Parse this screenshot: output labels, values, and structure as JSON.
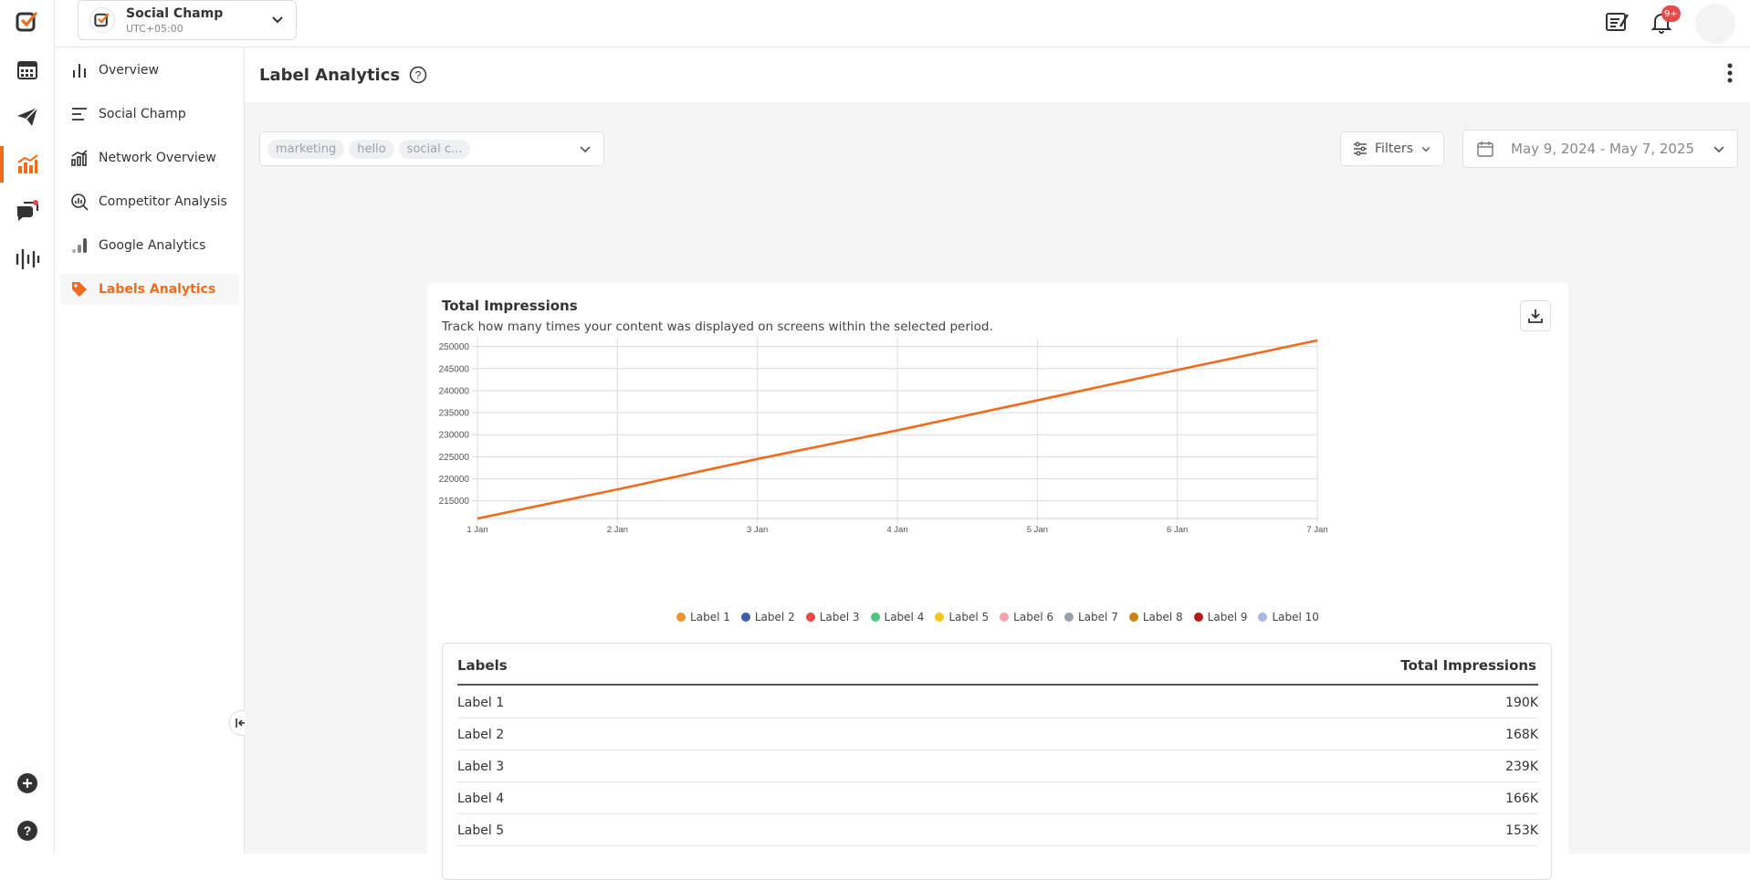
{
  "workspace": {
    "name": "Social Champ",
    "timezone": "UTC+05:00"
  },
  "notifications": {
    "badge": "9+"
  },
  "sidenav": {
    "items": [
      {
        "label": "Overview",
        "icon": "bar-chart-icon"
      },
      {
        "label": "Social Champ",
        "icon": "align-left-icon"
      },
      {
        "label": "Network Overview",
        "icon": "network-chart-icon"
      },
      {
        "label": "Competitor Analysis",
        "icon": "competitor-search-icon"
      },
      {
        "label": "Google Analytics",
        "icon": "google-analytics-icon"
      },
      {
        "label": "Labels Analytics",
        "icon": "tag-icon",
        "active": true
      }
    ]
  },
  "page": {
    "title": "Label Analytics"
  },
  "filters": {
    "chips": [
      "marketing",
      "hello",
      "social c..."
    ],
    "filters_label": "Filters",
    "date_range": "May 9, 2024 - May 7, 2025"
  },
  "card": {
    "title": "Total Impressions",
    "subtitle": "Track how many times your content was displayed on screens within the selected period."
  },
  "chart_data": {
    "type": "line",
    "x": [
      "1 Jan",
      "2 Jan",
      "3 Jan",
      "4 Jan",
      "5 Jan",
      "6 Jan",
      "7 Jan"
    ],
    "series": [
      {
        "values": [
          211000,
          217600,
          224500,
          231000,
          237800,
          244700,
          251400
        ],
        "color": "#f26b1d"
      }
    ],
    "yticks": [
      215000,
      220000,
      225000,
      230000,
      235000,
      240000,
      245000,
      250000
    ],
    "ylim": [
      211000,
      252000
    ],
    "grid": true,
    "legend_position": "bottom",
    "legend": [
      {
        "name": "Label 1",
        "color": "#f0932b"
      },
      {
        "name": "Label 2",
        "color": "#3b5fa8"
      },
      {
        "name": "Label 3",
        "color": "#e84a4a"
      },
      {
        "name": "Label 4",
        "color": "#4cc97a"
      },
      {
        "name": "Label 5",
        "color": "#f5c518"
      },
      {
        "name": "Label 6",
        "color": "#f4a4a4"
      },
      {
        "name": "Label 7",
        "color": "#9aa0b0"
      },
      {
        "name": "Label 8",
        "color": "#c9850f"
      },
      {
        "name": "Label 9",
        "color": "#b31b1b"
      },
      {
        "name": "Label 10",
        "color": "#a9b8e0"
      }
    ]
  },
  "table": {
    "headers": [
      "Labels",
      "Total Impressions"
    ],
    "rows": [
      [
        "Label 1",
        "190K"
      ],
      [
        "Label 2",
        "168K"
      ],
      [
        "Label 3",
        "239K"
      ],
      [
        "Label 4",
        "166K"
      ],
      [
        "Label 5",
        "153K"
      ]
    ]
  }
}
